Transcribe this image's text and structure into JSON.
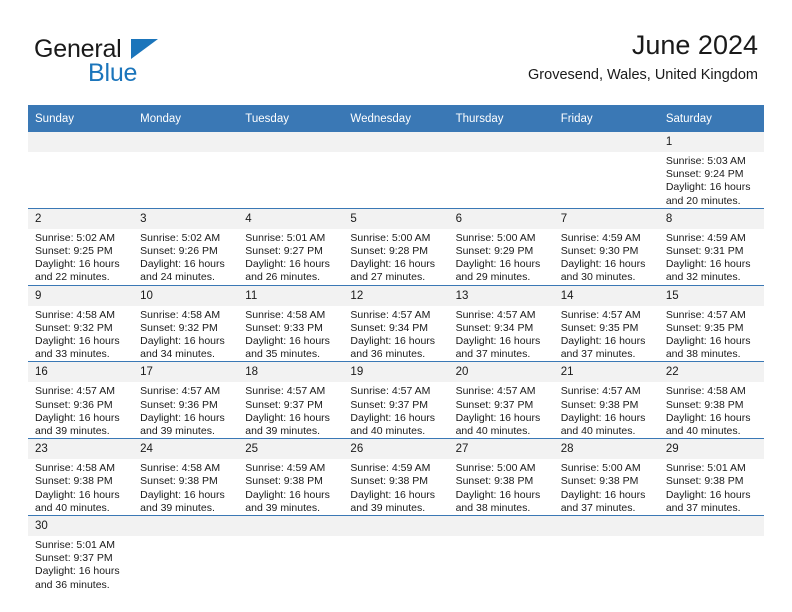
{
  "brand": {
    "name_part1": "General",
    "name_part2": "Blue",
    "accent_color": "#1b75bb"
  },
  "header": {
    "title": "June 2024",
    "subtitle": "Grovesend, Wales, United Kingdom"
  },
  "theme": {
    "header_row_bg": "#3a78b5",
    "daynum_bg": "#f2f2f2",
    "text_color": "#1a1a1a"
  },
  "weekday_headers": [
    "Sunday",
    "Monday",
    "Tuesday",
    "Wednesday",
    "Thursday",
    "Friday",
    "Saturday"
  ],
  "weeks": [
    [
      {
        "day": "",
        "sunrise": "",
        "sunset": "",
        "daylight_1": "",
        "daylight_2": ""
      },
      {
        "day": "",
        "sunrise": "",
        "sunset": "",
        "daylight_1": "",
        "daylight_2": ""
      },
      {
        "day": "",
        "sunrise": "",
        "sunset": "",
        "daylight_1": "",
        "daylight_2": ""
      },
      {
        "day": "",
        "sunrise": "",
        "sunset": "",
        "daylight_1": "",
        "daylight_2": ""
      },
      {
        "day": "",
        "sunrise": "",
        "sunset": "",
        "daylight_1": "",
        "daylight_2": ""
      },
      {
        "day": "",
        "sunrise": "",
        "sunset": "",
        "daylight_1": "",
        "daylight_2": ""
      },
      {
        "day": "1",
        "sunrise": "Sunrise: 5:03 AM",
        "sunset": "Sunset: 9:24 PM",
        "daylight_1": "Daylight: 16 hours",
        "daylight_2": "and 20 minutes."
      }
    ],
    [
      {
        "day": "2",
        "sunrise": "Sunrise: 5:02 AM",
        "sunset": "Sunset: 9:25 PM",
        "daylight_1": "Daylight: 16 hours",
        "daylight_2": "and 22 minutes."
      },
      {
        "day": "3",
        "sunrise": "Sunrise: 5:02 AM",
        "sunset": "Sunset: 9:26 PM",
        "daylight_1": "Daylight: 16 hours",
        "daylight_2": "and 24 minutes."
      },
      {
        "day": "4",
        "sunrise": "Sunrise: 5:01 AM",
        "sunset": "Sunset: 9:27 PM",
        "daylight_1": "Daylight: 16 hours",
        "daylight_2": "and 26 minutes."
      },
      {
        "day": "5",
        "sunrise": "Sunrise: 5:00 AM",
        "sunset": "Sunset: 9:28 PM",
        "daylight_1": "Daylight: 16 hours",
        "daylight_2": "and 27 minutes."
      },
      {
        "day": "6",
        "sunrise": "Sunrise: 5:00 AM",
        "sunset": "Sunset: 9:29 PM",
        "daylight_1": "Daylight: 16 hours",
        "daylight_2": "and 29 minutes."
      },
      {
        "day": "7",
        "sunrise": "Sunrise: 4:59 AM",
        "sunset": "Sunset: 9:30 PM",
        "daylight_1": "Daylight: 16 hours",
        "daylight_2": "and 30 minutes."
      },
      {
        "day": "8",
        "sunrise": "Sunrise: 4:59 AM",
        "sunset": "Sunset: 9:31 PM",
        "daylight_1": "Daylight: 16 hours",
        "daylight_2": "and 32 minutes."
      }
    ],
    [
      {
        "day": "9",
        "sunrise": "Sunrise: 4:58 AM",
        "sunset": "Sunset: 9:32 PM",
        "daylight_1": "Daylight: 16 hours",
        "daylight_2": "and 33 minutes."
      },
      {
        "day": "10",
        "sunrise": "Sunrise: 4:58 AM",
        "sunset": "Sunset: 9:32 PM",
        "daylight_1": "Daylight: 16 hours",
        "daylight_2": "and 34 minutes."
      },
      {
        "day": "11",
        "sunrise": "Sunrise: 4:58 AM",
        "sunset": "Sunset: 9:33 PM",
        "daylight_1": "Daylight: 16 hours",
        "daylight_2": "and 35 minutes."
      },
      {
        "day": "12",
        "sunrise": "Sunrise: 4:57 AM",
        "sunset": "Sunset: 9:34 PM",
        "daylight_1": "Daylight: 16 hours",
        "daylight_2": "and 36 minutes."
      },
      {
        "day": "13",
        "sunrise": "Sunrise: 4:57 AM",
        "sunset": "Sunset: 9:34 PM",
        "daylight_1": "Daylight: 16 hours",
        "daylight_2": "and 37 minutes."
      },
      {
        "day": "14",
        "sunrise": "Sunrise: 4:57 AM",
        "sunset": "Sunset: 9:35 PM",
        "daylight_1": "Daylight: 16 hours",
        "daylight_2": "and 37 minutes."
      },
      {
        "day": "15",
        "sunrise": "Sunrise: 4:57 AM",
        "sunset": "Sunset: 9:35 PM",
        "daylight_1": "Daylight: 16 hours",
        "daylight_2": "and 38 minutes."
      }
    ],
    [
      {
        "day": "16",
        "sunrise": "Sunrise: 4:57 AM",
        "sunset": "Sunset: 9:36 PM",
        "daylight_1": "Daylight: 16 hours",
        "daylight_2": "and 39 minutes."
      },
      {
        "day": "17",
        "sunrise": "Sunrise: 4:57 AM",
        "sunset": "Sunset: 9:36 PM",
        "daylight_1": "Daylight: 16 hours",
        "daylight_2": "and 39 minutes."
      },
      {
        "day": "18",
        "sunrise": "Sunrise: 4:57 AM",
        "sunset": "Sunset: 9:37 PM",
        "daylight_1": "Daylight: 16 hours",
        "daylight_2": "and 39 minutes."
      },
      {
        "day": "19",
        "sunrise": "Sunrise: 4:57 AM",
        "sunset": "Sunset: 9:37 PM",
        "daylight_1": "Daylight: 16 hours",
        "daylight_2": "and 40 minutes."
      },
      {
        "day": "20",
        "sunrise": "Sunrise: 4:57 AM",
        "sunset": "Sunset: 9:37 PM",
        "daylight_1": "Daylight: 16 hours",
        "daylight_2": "and 40 minutes."
      },
      {
        "day": "21",
        "sunrise": "Sunrise: 4:57 AM",
        "sunset": "Sunset: 9:38 PM",
        "daylight_1": "Daylight: 16 hours",
        "daylight_2": "and 40 minutes."
      },
      {
        "day": "22",
        "sunrise": "Sunrise: 4:58 AM",
        "sunset": "Sunset: 9:38 PM",
        "daylight_1": "Daylight: 16 hours",
        "daylight_2": "and 40 minutes."
      }
    ],
    [
      {
        "day": "23",
        "sunrise": "Sunrise: 4:58 AM",
        "sunset": "Sunset: 9:38 PM",
        "daylight_1": "Daylight: 16 hours",
        "daylight_2": "and 40 minutes."
      },
      {
        "day": "24",
        "sunrise": "Sunrise: 4:58 AM",
        "sunset": "Sunset: 9:38 PM",
        "daylight_1": "Daylight: 16 hours",
        "daylight_2": "and 39 minutes."
      },
      {
        "day": "25",
        "sunrise": "Sunrise: 4:59 AM",
        "sunset": "Sunset: 9:38 PM",
        "daylight_1": "Daylight: 16 hours",
        "daylight_2": "and 39 minutes."
      },
      {
        "day": "26",
        "sunrise": "Sunrise: 4:59 AM",
        "sunset": "Sunset: 9:38 PM",
        "daylight_1": "Daylight: 16 hours",
        "daylight_2": "and 39 minutes."
      },
      {
        "day": "27",
        "sunrise": "Sunrise: 5:00 AM",
        "sunset": "Sunset: 9:38 PM",
        "daylight_1": "Daylight: 16 hours",
        "daylight_2": "and 38 minutes."
      },
      {
        "day": "28",
        "sunrise": "Sunrise: 5:00 AM",
        "sunset": "Sunset: 9:38 PM",
        "daylight_1": "Daylight: 16 hours",
        "daylight_2": "and 37 minutes."
      },
      {
        "day": "29",
        "sunrise": "Sunrise: 5:01 AM",
        "sunset": "Sunset: 9:38 PM",
        "daylight_1": "Daylight: 16 hours",
        "daylight_2": "and 37 minutes."
      }
    ],
    [
      {
        "day": "30",
        "sunrise": "Sunrise: 5:01 AM",
        "sunset": "Sunset: 9:37 PM",
        "daylight_1": "Daylight: 16 hours",
        "daylight_2": "and 36 minutes."
      },
      {
        "day": "",
        "sunrise": "",
        "sunset": "",
        "daylight_1": "",
        "daylight_2": ""
      },
      {
        "day": "",
        "sunrise": "",
        "sunset": "",
        "daylight_1": "",
        "daylight_2": ""
      },
      {
        "day": "",
        "sunrise": "",
        "sunset": "",
        "daylight_1": "",
        "daylight_2": ""
      },
      {
        "day": "",
        "sunrise": "",
        "sunset": "",
        "daylight_1": "",
        "daylight_2": ""
      },
      {
        "day": "",
        "sunrise": "",
        "sunset": "",
        "daylight_1": "",
        "daylight_2": ""
      },
      {
        "day": "",
        "sunrise": "",
        "sunset": "",
        "daylight_1": "",
        "daylight_2": ""
      }
    ]
  ]
}
